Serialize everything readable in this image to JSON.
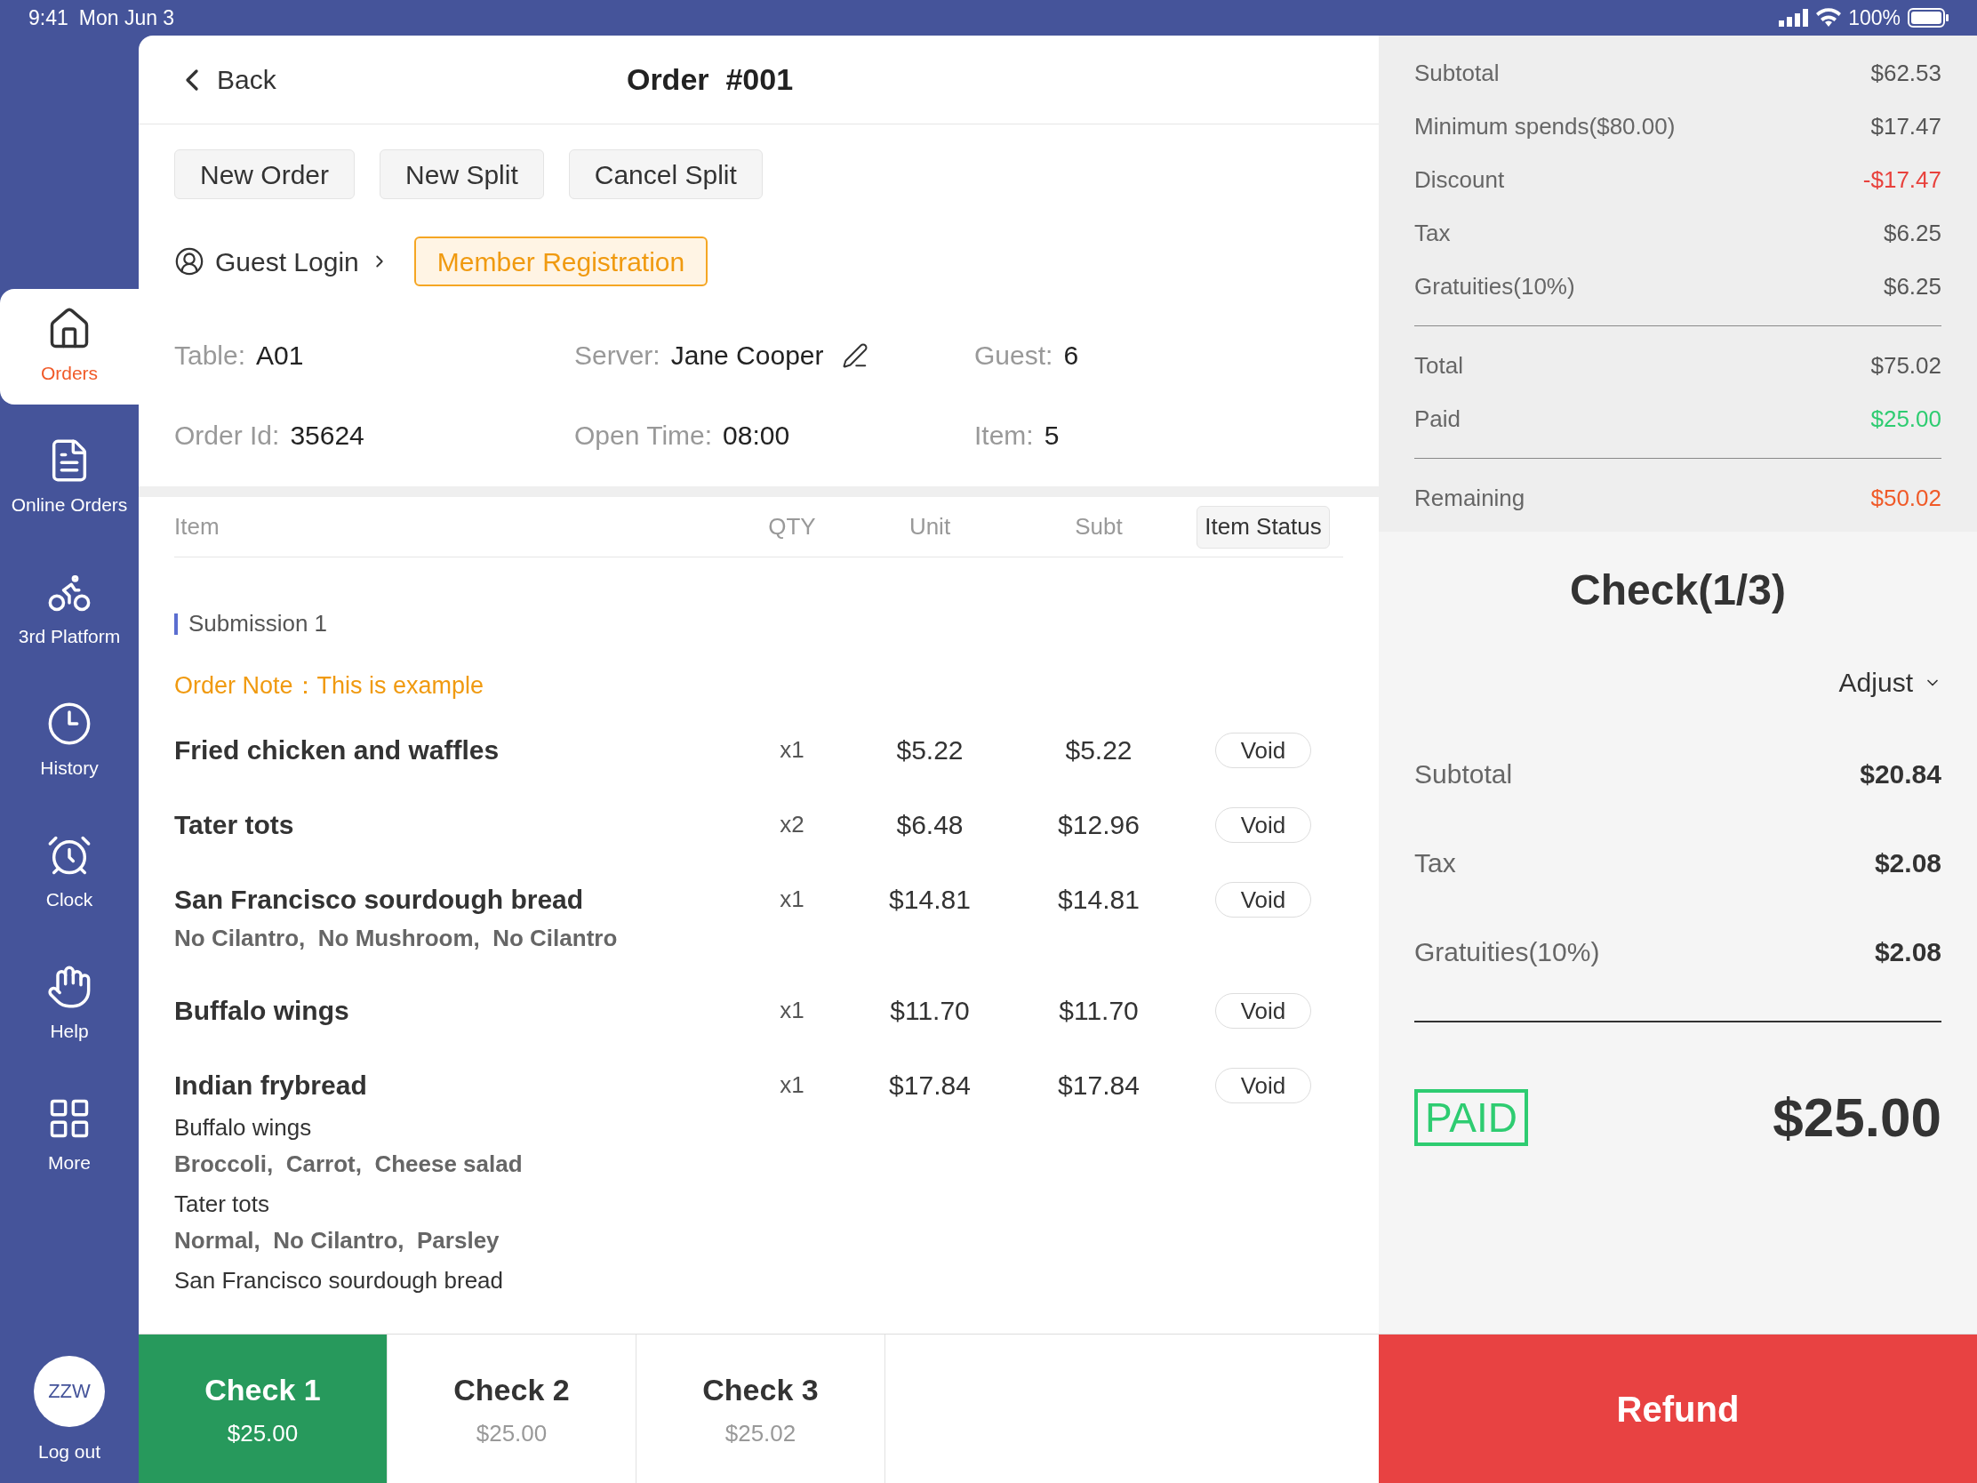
{
  "status_bar": {
    "time": "9:41",
    "date": "Mon Jun 3",
    "battery": "100%"
  },
  "sidebar": {
    "items": [
      {
        "label": "Orders",
        "selected": true
      },
      {
        "label": "Online Orders",
        "selected": false
      },
      {
        "label": "3rd Platform",
        "selected": false
      },
      {
        "label": "History",
        "selected": false
      },
      {
        "label": "Clock",
        "selected": false
      },
      {
        "label": "Help",
        "selected": false
      },
      {
        "label": "More",
        "selected": false
      }
    ],
    "user": {
      "initials": "ZZW",
      "logout": "Log out"
    }
  },
  "header": {
    "back": "Back",
    "title": "Order  #001"
  },
  "actions": [
    "New Order",
    "New Split",
    "Cancel Split"
  ],
  "guest_login": "Guest Login",
  "member_registration": "Member Registration",
  "info": [
    {
      "label": "Table:",
      "value": "A01",
      "editable": false
    },
    {
      "label": "Server:",
      "value": "Jane Cooper",
      "editable": true
    },
    {
      "label": "Guest:",
      "value": "6",
      "editable": false
    },
    {
      "label": "Order Id:",
      "value": "35624",
      "editable": false
    },
    {
      "label": "Open Time:",
      "value": "08:00",
      "editable": false
    },
    {
      "label": "Item:",
      "value": "5",
      "editable": false
    }
  ],
  "table": {
    "columns": [
      {
        "label": "Item",
        "kind": "text"
      },
      {
        "label": "QTY",
        "kind": "text"
      },
      {
        "label": "Unit",
        "kind": "text"
      },
      {
        "label": "Subt",
        "kind": "text"
      },
      {
        "label": "Item Status",
        "kind": "button"
      }
    ],
    "submission": "Submission 1",
    "order_note": "Order Note：This is example",
    "rows": [
      {
        "name": "Fried chicken and waffles",
        "qty": "x1",
        "unit": "$5.22",
        "subt": "$5.22",
        "action": "Void",
        "details": []
      },
      {
        "name": "Tater tots",
        "qty": "x2",
        "unit": "$6.48",
        "subt": "$12.96",
        "action": "Void",
        "details": []
      },
      {
        "name": "San Francisco sourdough bread",
        "qty": "x1",
        "unit": "$14.81",
        "subt": "$14.81",
        "action": "Void",
        "details": [
          {
            "kind": "modifiers",
            "text": "No Cilantro,  No Mushroom,  No Cilantro"
          }
        ]
      },
      {
        "name": "Buffalo wings",
        "qty": "x1",
        "unit": "$11.70",
        "subt": "$11.70",
        "action": "Void",
        "details": []
      },
      {
        "name": "Indian frybread",
        "qty": "x1",
        "unit": "$17.84",
        "subt": "$17.84",
        "action": "Void",
        "details": [
          {
            "kind": "name",
            "text": "Buffalo wings"
          },
          {
            "kind": "modifiers",
            "text": "Broccoli,  Carrot,  Cheese salad"
          },
          {
            "kind": "name",
            "text": "Tater tots"
          },
          {
            "kind": "modifiers",
            "text": "Normal,  No Cilantro,  Parsley"
          },
          {
            "kind": "name",
            "text": "San Francisco sourdough bread"
          }
        ]
      }
    ]
  },
  "summary": [
    [
      {
        "label": "Subtotal",
        "value": "$62.53",
        "color": "#555555"
      },
      {
        "label": "Minimum spends($80.00)",
        "value": "$17.47",
        "color": "#555555"
      },
      {
        "label": "Discount",
        "value": "-$17.47",
        "color": "#e8413c"
      },
      {
        "label": "Tax",
        "value": "$6.25",
        "color": "#555555"
      },
      {
        "label": "Gratuities(10%)",
        "value": "$6.25",
        "color": "#555555"
      }
    ],
    [
      {
        "label": "Total",
        "value": "$75.02",
        "color": "#555555"
      },
      {
        "label": "Paid",
        "value": "$25.00",
        "color": "#2ecc71"
      }
    ],
    [
      {
        "label": "Remaining",
        "value": "$50.02",
        "color": "#f05a28"
      }
    ]
  ],
  "check": {
    "title": "Check(1/3)",
    "adjust": "Adjust",
    "rows": [
      {
        "label": "Subtotal",
        "value": "$20.84"
      },
      {
        "label": "Tax",
        "value": "$2.08"
      },
      {
        "label": "Gratuities(10%)",
        "value": "$2.08"
      }
    ],
    "stamp": "PAID",
    "amount": "$25.00"
  },
  "checks": [
    {
      "label": "Check 1",
      "amount": "$25.00",
      "selected": true
    },
    {
      "label": "Check 2",
      "amount": "$25.00",
      "selected": false
    },
    {
      "label": "Check 3",
      "amount": "$25.02",
      "selected": false
    }
  ],
  "refund": "Refund"
}
